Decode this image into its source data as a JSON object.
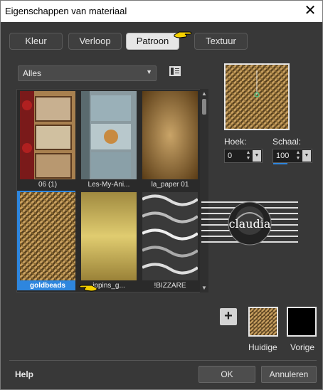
{
  "window": {
    "title": "Eigenschappen van materiaal",
    "close_glyph": "✕"
  },
  "tabs": [
    {
      "label": "Kleur",
      "active": false
    },
    {
      "label": "Verloop",
      "active": false
    },
    {
      "label": "Patroon",
      "active": true
    },
    {
      "label": "Textuur",
      "active": false
    }
  ],
  "category": {
    "value": "Alles"
  },
  "patterns": [
    {
      "caption": "06 (1)",
      "selected": false
    },
    {
      "caption": "Les-My-Ani...",
      "selected": false
    },
    {
      "caption": "la_paper 01",
      "selected": false
    },
    {
      "caption": "goldbeads",
      "selected": true
    },
    {
      "caption": "ippins_g...",
      "selected": false
    },
    {
      "caption": "!BIZZARE",
      "selected": false
    }
  ],
  "params": {
    "angle_label": "Hoek:",
    "angle_value": "0",
    "scale_label": "Schaal:",
    "scale_value": "100"
  },
  "watermark": {
    "text": "claudia"
  },
  "swatches": {
    "current_label": "Huidige",
    "previous_label": "Vorige"
  },
  "footer": {
    "help": "Help",
    "ok": "OK",
    "cancel": "Annuleren"
  },
  "colors": {
    "accent": "#2e86de",
    "pointer": "#f5d000"
  }
}
